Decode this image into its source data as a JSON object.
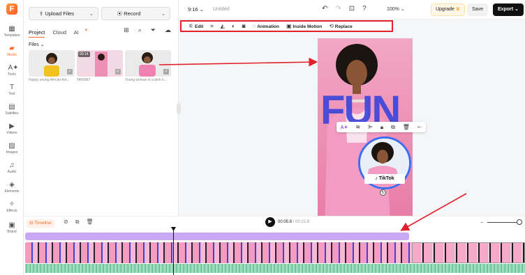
{
  "app": {
    "logo_letter": "F"
  },
  "sidebar": {
    "items": [
      {
        "label": "Templates",
        "icon": "templates-icon"
      },
      {
        "label": "Media",
        "icon": "media-icon",
        "active": true
      },
      {
        "label": "Tools",
        "icon": "ai-tools-icon"
      },
      {
        "label": "Text",
        "icon": "text-icon"
      },
      {
        "label": "Subtitles",
        "icon": "subtitles-icon"
      },
      {
        "label": "Videos",
        "icon": "videos-icon"
      },
      {
        "label": "Images",
        "icon": "images-icon"
      },
      {
        "label": "Audio",
        "icon": "audio-icon"
      },
      {
        "label": "Elements",
        "icon": "elements-icon"
      },
      {
        "label": "Effects",
        "icon": "effects-icon"
      },
      {
        "label": "Brand",
        "icon": "brand-icon"
      }
    ]
  },
  "media_panel": {
    "upload_label": "Upload Files",
    "record_label": "Record",
    "tabs": [
      "Project",
      "Cloud",
      "AI"
    ],
    "files_label": "Files",
    "files": [
      {
        "caption": "Happy young African Am...",
        "duration": ""
      },
      {
        "caption": "5460987",
        "duration": "00:14"
      },
      {
        "caption": "Young woman in a pink h...",
        "duration": ""
      }
    ]
  },
  "topbar": {
    "aspect_ratio": "9:16",
    "project_title": "Untitled",
    "zoom": "100%",
    "upgrade_label": "Upgrade",
    "save_label": "Save",
    "export_label": "Export"
  },
  "context_toolbar": {
    "edit_label": "Edit",
    "animation_label": "Animation",
    "inside_motion_label": "Inside Motion",
    "replace_label": "Replace"
  },
  "canvas": {
    "headline": "FUN",
    "sticker_label": "TikTok"
  },
  "timeline": {
    "timeline_label": "Timeline",
    "current_time": "00:05.8",
    "total_time": "00:22.8"
  },
  "colors": {
    "accent": "#ff6a2c",
    "highlight_box": "#e0202b",
    "fun_text": "#3d45d9",
    "export_bg": "#111111"
  }
}
